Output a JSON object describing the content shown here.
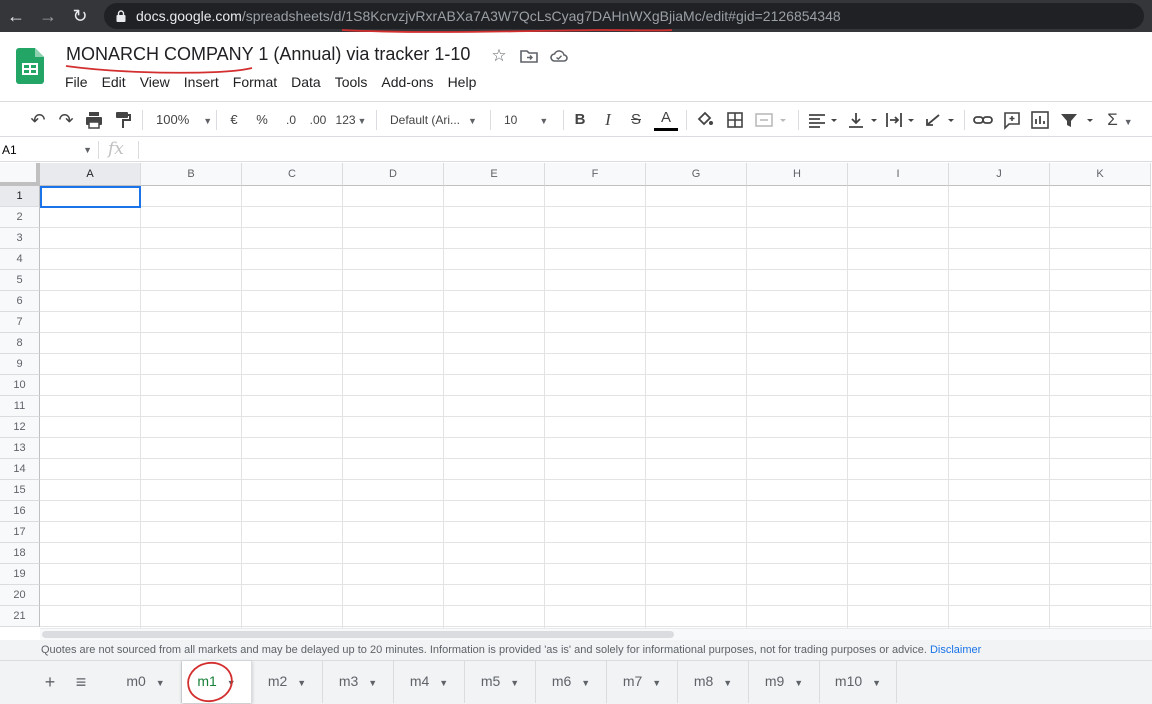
{
  "browser": {
    "url_host": "docs.google.com",
    "url_path": "/spreadsheets/d/1S8KcrvzjvRxrABXa7A3W7QcLsCyag7DAHnWXgBjiaMc/edit#gid=2126854348"
  },
  "document": {
    "title": "MONARCH COMPANY 1 (Annual) via tracker 1-10"
  },
  "menu": [
    "File",
    "Edit",
    "View",
    "Insert",
    "Format",
    "Data",
    "Tools",
    "Add-ons",
    "Help"
  ],
  "toolbar": {
    "zoom": "100%",
    "currency": "€",
    "percent": "%",
    "decrease_decimals": ".0",
    "increase_decimals": ".00",
    "more_formats": "123",
    "font_family": "Default (Ari...",
    "font_size": "10",
    "bold": "B",
    "italic": "I",
    "strikethrough": "S",
    "text_color": "A",
    "sigma": "Σ"
  },
  "formula_bar": {
    "cell_ref": "A1",
    "fx": "fx",
    "value": ""
  },
  "grid": {
    "columns": [
      "A",
      "B",
      "C",
      "D",
      "E",
      "F",
      "G",
      "H",
      "I",
      "J",
      "K"
    ],
    "rows": [
      "1",
      "2",
      "3",
      "4",
      "5",
      "6",
      "7",
      "8",
      "9",
      "10",
      "11",
      "12",
      "13",
      "14",
      "15",
      "16",
      "17",
      "18",
      "19",
      "20",
      "21"
    ],
    "selected_cell": "A1"
  },
  "quote_notice": {
    "text": "Quotes are not sourced from all markets and may be delayed up to 20 minutes. Information is provided 'as is' and solely for informational purposes, not for trading purposes or advice.",
    "link": "Disclaimer"
  },
  "sheets": {
    "tabs": [
      "m0",
      "m1",
      "m2",
      "m3",
      "m4",
      "m5",
      "m6",
      "m7",
      "m8",
      "m9",
      "m10"
    ],
    "active": "m1"
  },
  "colors": {
    "accent": "#1a73e8",
    "sheets_green": "#188038",
    "annotation_red": "#d32f2f"
  }
}
